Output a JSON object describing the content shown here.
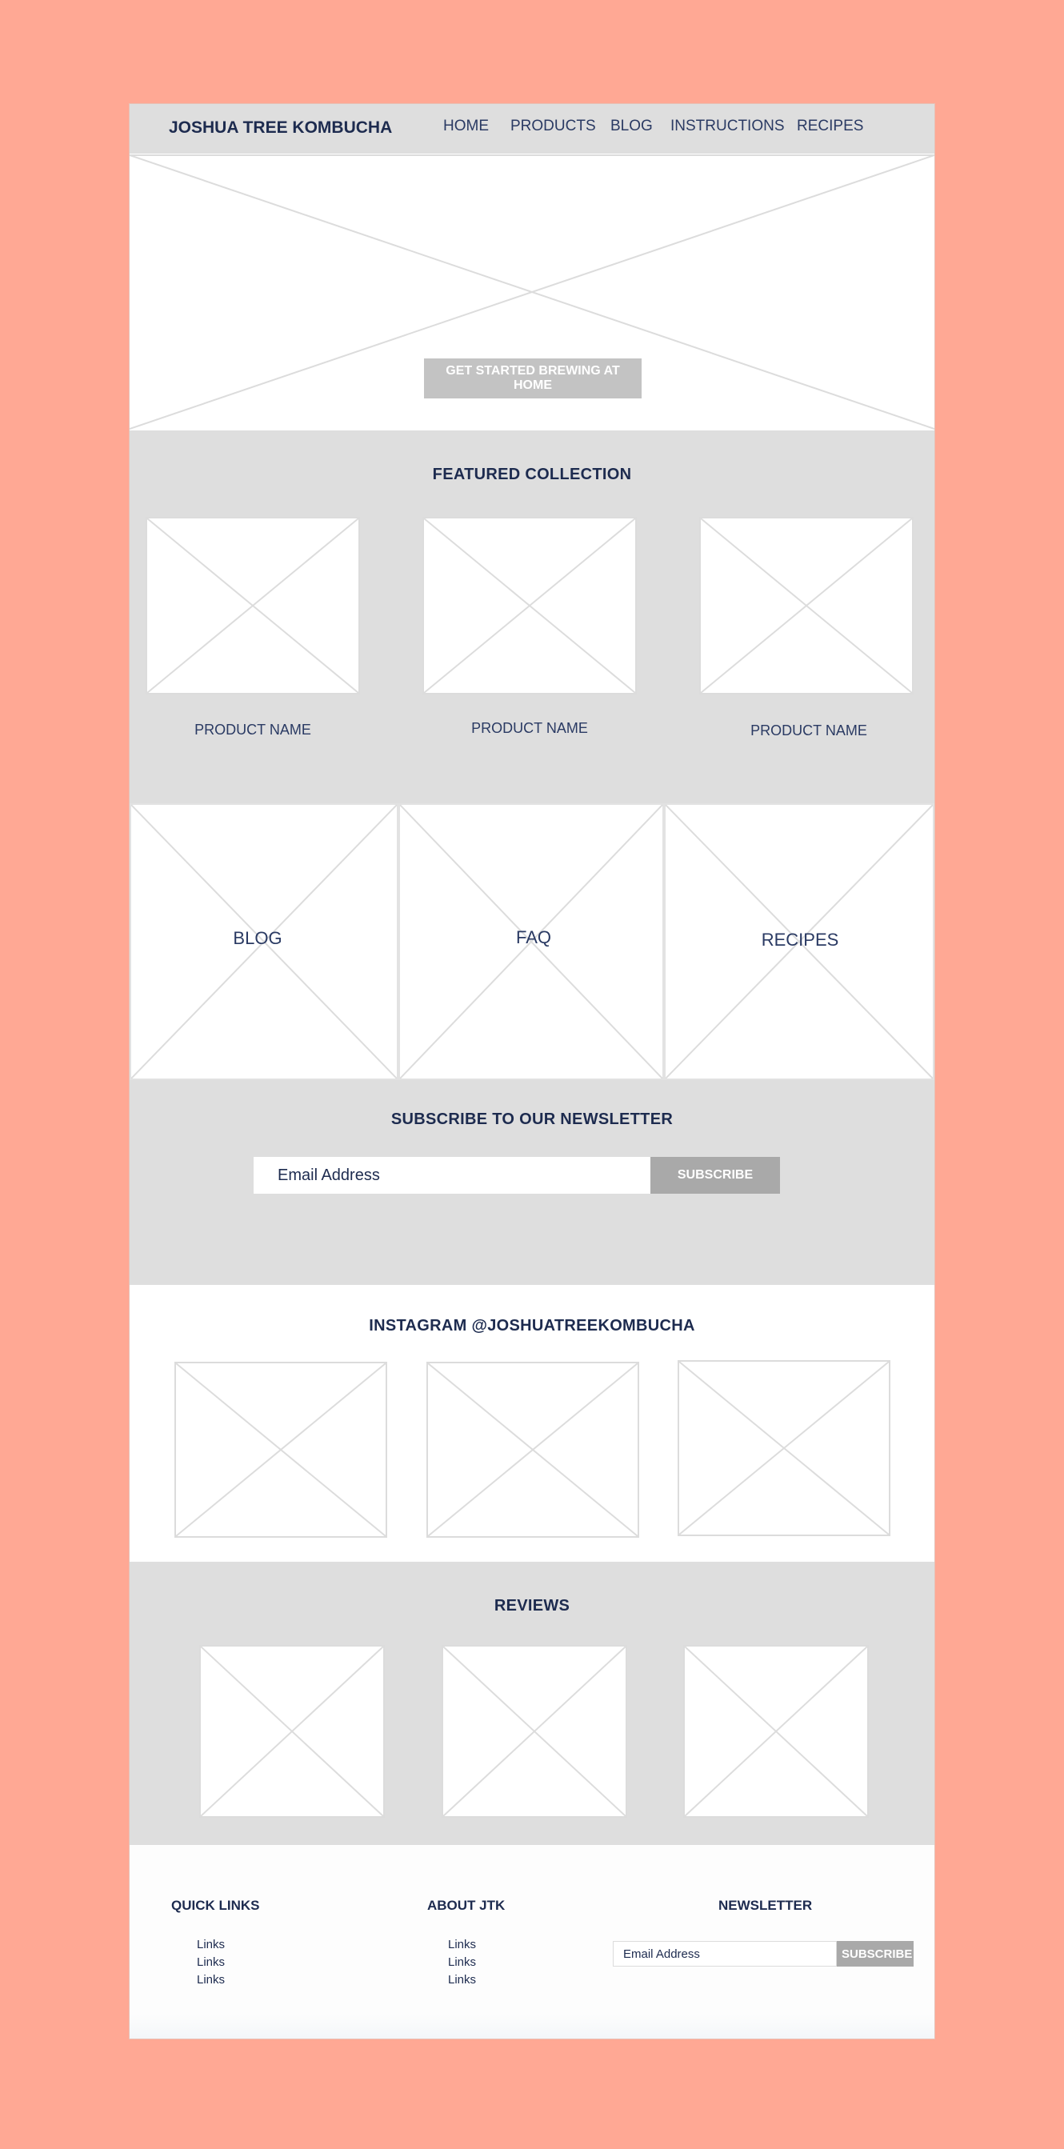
{
  "header": {
    "brand": "JOSHUA TREE KOMBUCHA",
    "nav": [
      "HOME",
      "PRODUCTS",
      "BLOG",
      "INSTRUCTIONS",
      "RECIPES"
    ]
  },
  "hero": {
    "cta_label": "GET STARTED BREWING AT HOME"
  },
  "featured": {
    "title": "FEATURED COLLECTION",
    "products": [
      "PRODUCT NAME",
      "PRODUCT NAME",
      "PRODUCT NAME"
    ]
  },
  "tiles": [
    "BLOG",
    "FAQ",
    "RECIPES"
  ],
  "newsletter": {
    "title": "SUBSCRIBE TO OUR NEWSLETTER",
    "placeholder": "Email Address",
    "button": "SUBSCRIBE"
  },
  "instagram": {
    "title": "INSTAGRAM @JOSHUATREEKOMBUCHA"
  },
  "reviews": {
    "title": "REVIEWS"
  },
  "footer": {
    "quick_links": {
      "title": "QUICK LINKS",
      "links": [
        "Links",
        "Links",
        "Links"
      ]
    },
    "about": {
      "title": "ABOUT JTK",
      "links": [
        "Links",
        "Links",
        "Links"
      ]
    },
    "newsletter": {
      "title": "NEWSLETTER",
      "placeholder": "Email Address",
      "button": "SUBSCRIBE"
    }
  },
  "colors": {
    "background": "#ffa894",
    "panel_gray": "#dedede",
    "text_navy": "#1d2b4f",
    "button_gray": "#a9a9a9"
  }
}
